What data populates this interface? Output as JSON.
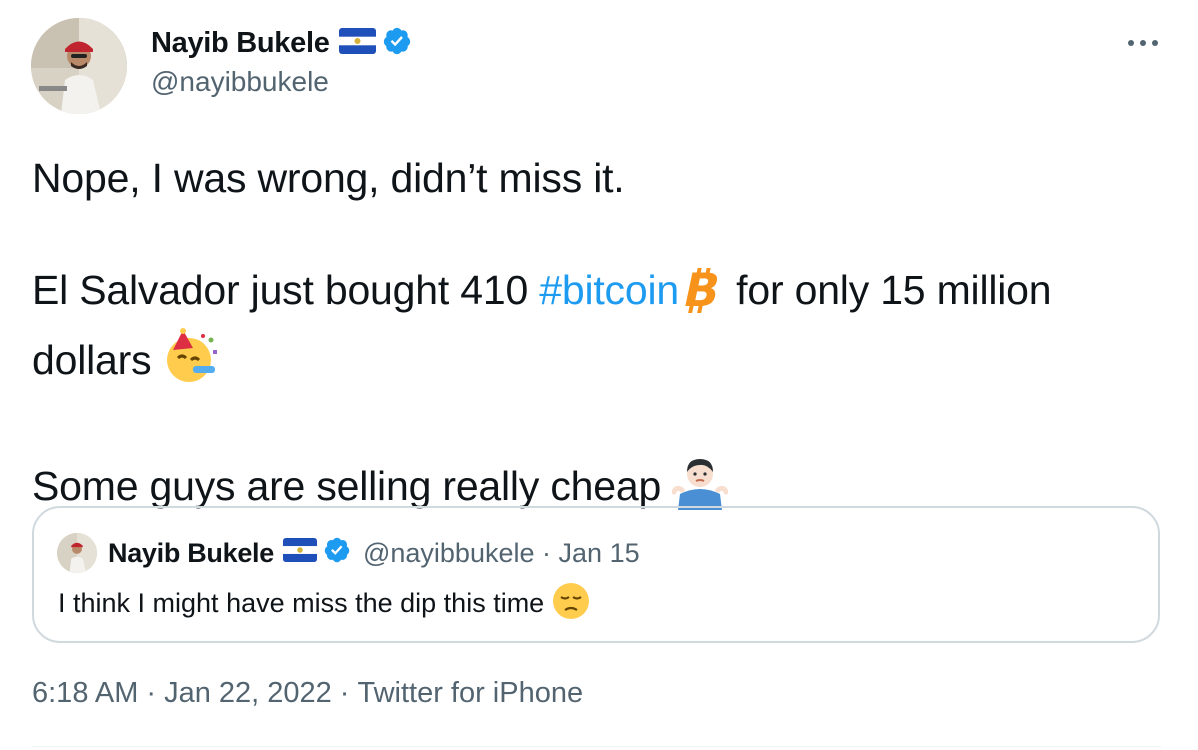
{
  "author": {
    "name": "Nayib Bukele",
    "handle": "@nayibbukele",
    "flag_icon": "el-salvador-flag-icon",
    "verified_icon": "verified-badge-icon"
  },
  "tweet": {
    "line1": "Nope, I was wrong, didn’t miss it.",
    "line2_before": "El Salvador just bought 410 ",
    "hashtag": "#bitcoin",
    "line2_after": " for only 15 million dollars",
    "line3": "Some guys are selling really cheap",
    "bitcoin_icon": "bitcoin-icon",
    "party_icon": "party-face-icon",
    "shrug_icon": "shrug-icon"
  },
  "quoted_tweet": {
    "name": "Nayib Bukele",
    "handle": "@nayibbukele",
    "separator": "·",
    "date": "Jan 15",
    "text": "I think I might have miss the dip this time",
    "emoji_icon": "pensive-face-icon"
  },
  "meta": {
    "time": "6:18 AM",
    "separator": "·",
    "date": "Jan 22, 2022",
    "source": "Twitter for iPhone"
  },
  "colors": {
    "accent": "#1d9bf0",
    "secondary_text": "#536471",
    "border": "#cfd9de"
  }
}
